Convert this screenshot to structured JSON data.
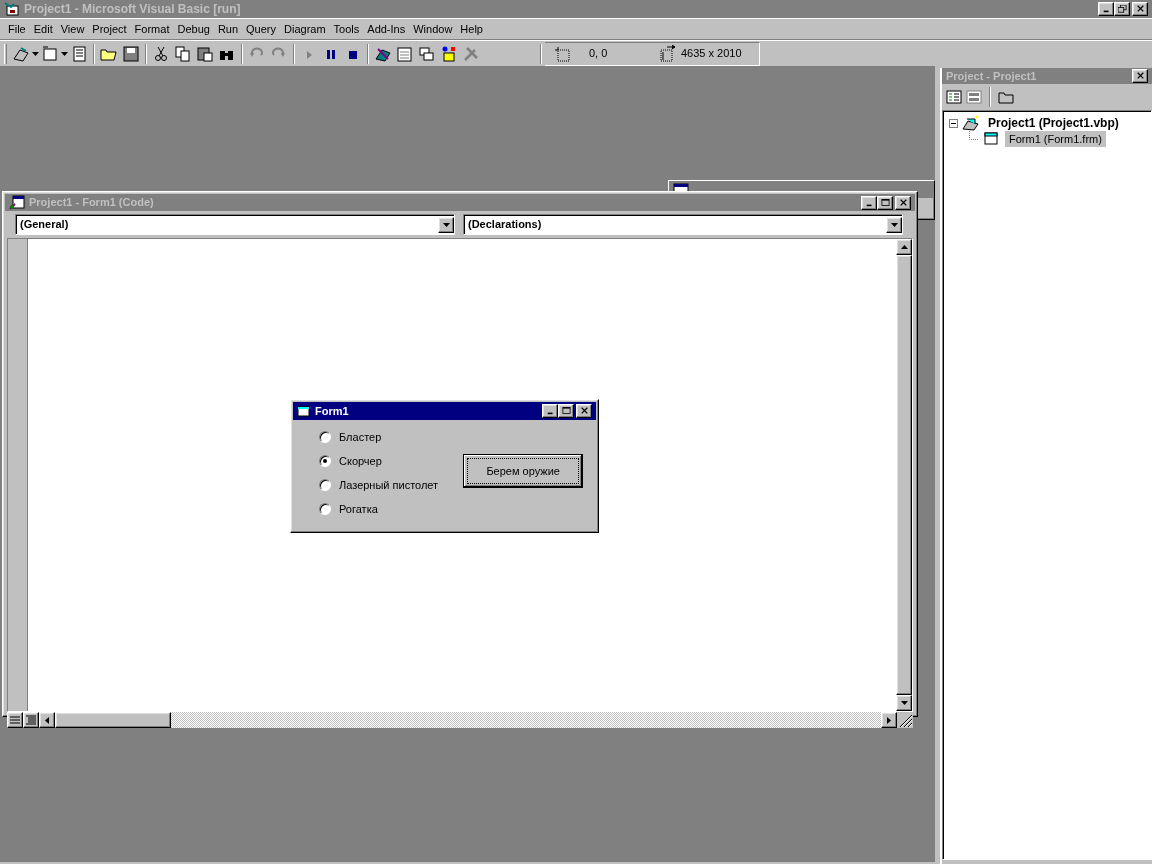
{
  "window": {
    "title": "Project1 - Microsoft Visual Basic [run]"
  },
  "menu": [
    "File",
    "Edit",
    "View",
    "Project",
    "Format",
    "Debug",
    "Run",
    "Query",
    "Diagram",
    "Tools",
    "Add-Ins",
    "Window",
    "Help"
  ],
  "toolbar": {
    "position": "0, 0",
    "size": "4635 x 2010"
  },
  "code_window": {
    "title": "Project1 - Form1 (Code)",
    "object_combo": "(General)",
    "procedure_combo": "(Declarations)"
  },
  "form": {
    "title": "Form1",
    "options": [
      {
        "label": "Бластер",
        "selected": false
      },
      {
        "label": "Скорчер",
        "selected": true
      },
      {
        "label": "Лазерный пистолет",
        "selected": false
      },
      {
        "label": "Рогатка",
        "selected": false
      }
    ],
    "button": "Берем оружие"
  },
  "project_explorer": {
    "title": "Project - Project1",
    "tree": [
      {
        "label": "Project1 (Project1.vbp)",
        "selected": false,
        "expanded": true,
        "children": [
          {
            "label": "Form1 (Form1.frm)",
            "selected": true
          }
        ]
      }
    ]
  }
}
